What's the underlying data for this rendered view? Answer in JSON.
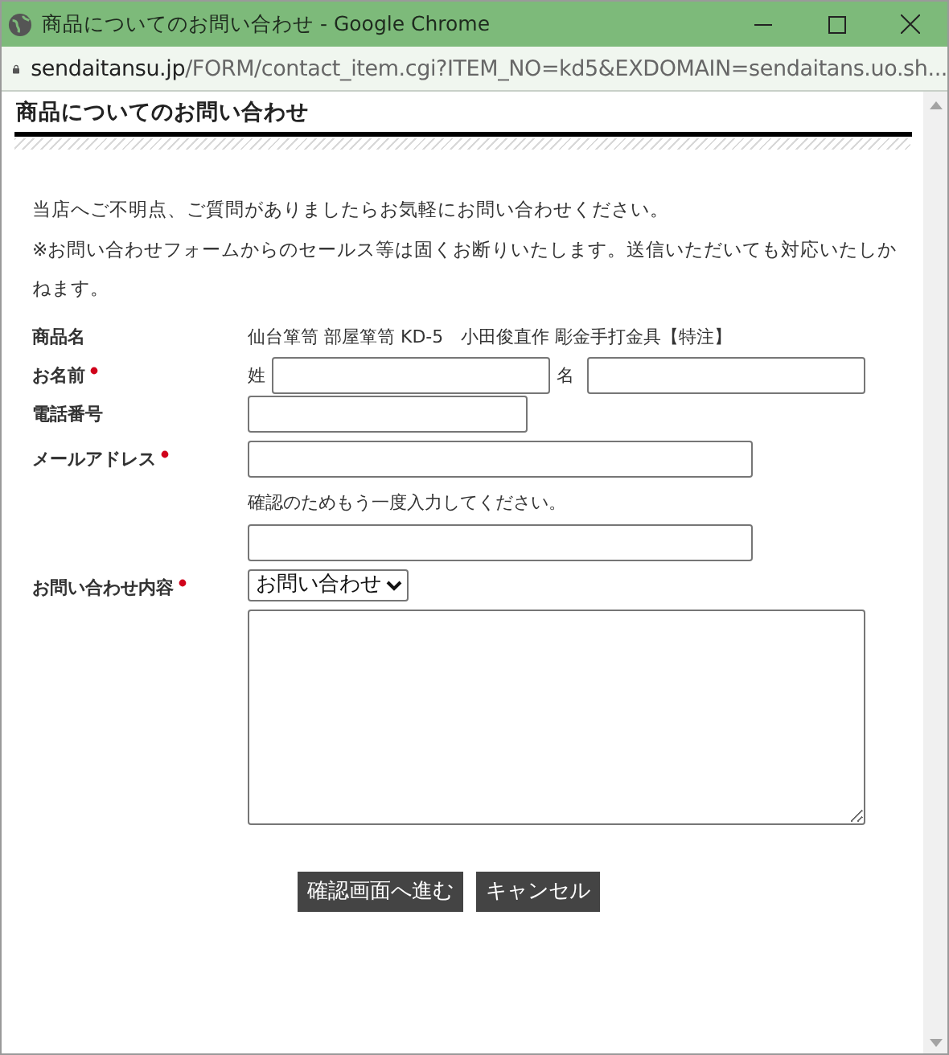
{
  "window": {
    "title": "商品についてのお問い合わせ - Google Chrome"
  },
  "address_bar": {
    "host": "sendaitansu.jp",
    "path": "/FORM/contact_item.cgi?ITEM_NO=kd5&EXDOMAIN=sendaitans.uo.sh..."
  },
  "page": {
    "heading": "商品についてのお問い合わせ",
    "intro": [
      "当店へご不明点、ご質問がありましたらお気軽にお問い合わせください。",
      "※お問い合わせフォームからのセールス等は固くお断りいたします。送信いただいても対応いたしかねます。"
    ],
    "form": {
      "rows": [
        {
          "kind": "static",
          "label": "商品名",
          "required": false,
          "value": "仙台箪笥 部屋箪笥 KD-5　小田俊直作 彫金手打金具【特注】"
        },
        {
          "kind": "name",
          "label": "お名前",
          "required": true,
          "fields": [
            {
              "prefix": "姓"
            },
            {
              "prefix": "名"
            }
          ]
        },
        {
          "kind": "phone",
          "label": "電話番号",
          "required": false
        },
        {
          "kind": "email",
          "label": "メールアドレス",
          "required": true,
          "confirm_note": "確認のためもう一度入力してください。"
        },
        {
          "kind": "select",
          "label": "お問い合わせ内容",
          "required": true,
          "value": "お問い合わせ"
        }
      ]
    },
    "buttons": [
      "確認画面へ進む",
      "キャンセル"
    ]
  }
}
